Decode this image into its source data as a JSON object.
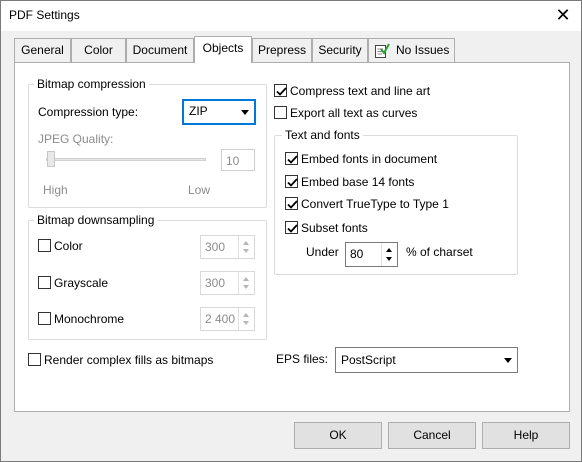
{
  "window": {
    "title": "PDF Settings",
    "close_glyph": "✕"
  },
  "tabs": [
    {
      "label": "General"
    },
    {
      "label": "Color"
    },
    {
      "label": "Document"
    },
    {
      "label": "Objects"
    },
    {
      "label": "Prepress"
    },
    {
      "label": "Security"
    },
    {
      "label": "No Issues"
    }
  ],
  "bitmap_compression": {
    "title": "Bitmap compression",
    "compression_type_label": "Compression type:",
    "compression_type_value": "ZIP",
    "jpeg_quality_label": "JPEG Quality:",
    "jpeg_quality_value": "10",
    "slider_min_label": "High",
    "slider_max_label": "Low"
  },
  "bitmap_downsampling": {
    "title": "Bitmap downsampling",
    "color": {
      "label": "Color",
      "checked": false,
      "value": "300"
    },
    "grayscale": {
      "label": "Grayscale",
      "checked": false,
      "value": "300"
    },
    "monochrome": {
      "label": "Monochrome",
      "checked": false,
      "value": "2 400"
    }
  },
  "render_complex_fills": {
    "label": "Render complex fills as bitmaps",
    "checked": false
  },
  "compress_text": {
    "label": "Compress text and line art",
    "checked": true
  },
  "export_text_as_curves": {
    "label": "Export all text as curves",
    "checked": false
  },
  "text_and_fonts": {
    "title": "Text and fonts",
    "embed_fonts": {
      "label": "Embed fonts in document",
      "checked": true
    },
    "embed_base14": {
      "label": "Embed base 14 fonts",
      "checked": true
    },
    "convert_truetype": {
      "label": "Convert TrueType to Type 1",
      "checked": true
    },
    "subset_fonts": {
      "label": "Subset fonts",
      "checked": true
    },
    "under_label": "Under",
    "under_value": "80",
    "percent_label": "% of charset"
  },
  "eps_files": {
    "label": "EPS files:",
    "value": "PostScript"
  },
  "buttons": {
    "ok": "OK",
    "cancel": "Cancel",
    "help": "Help"
  },
  "colors": {
    "focus_border": "#0078d7",
    "check_color": "#000000",
    "tab_icon_check": "#2e9d3a"
  }
}
